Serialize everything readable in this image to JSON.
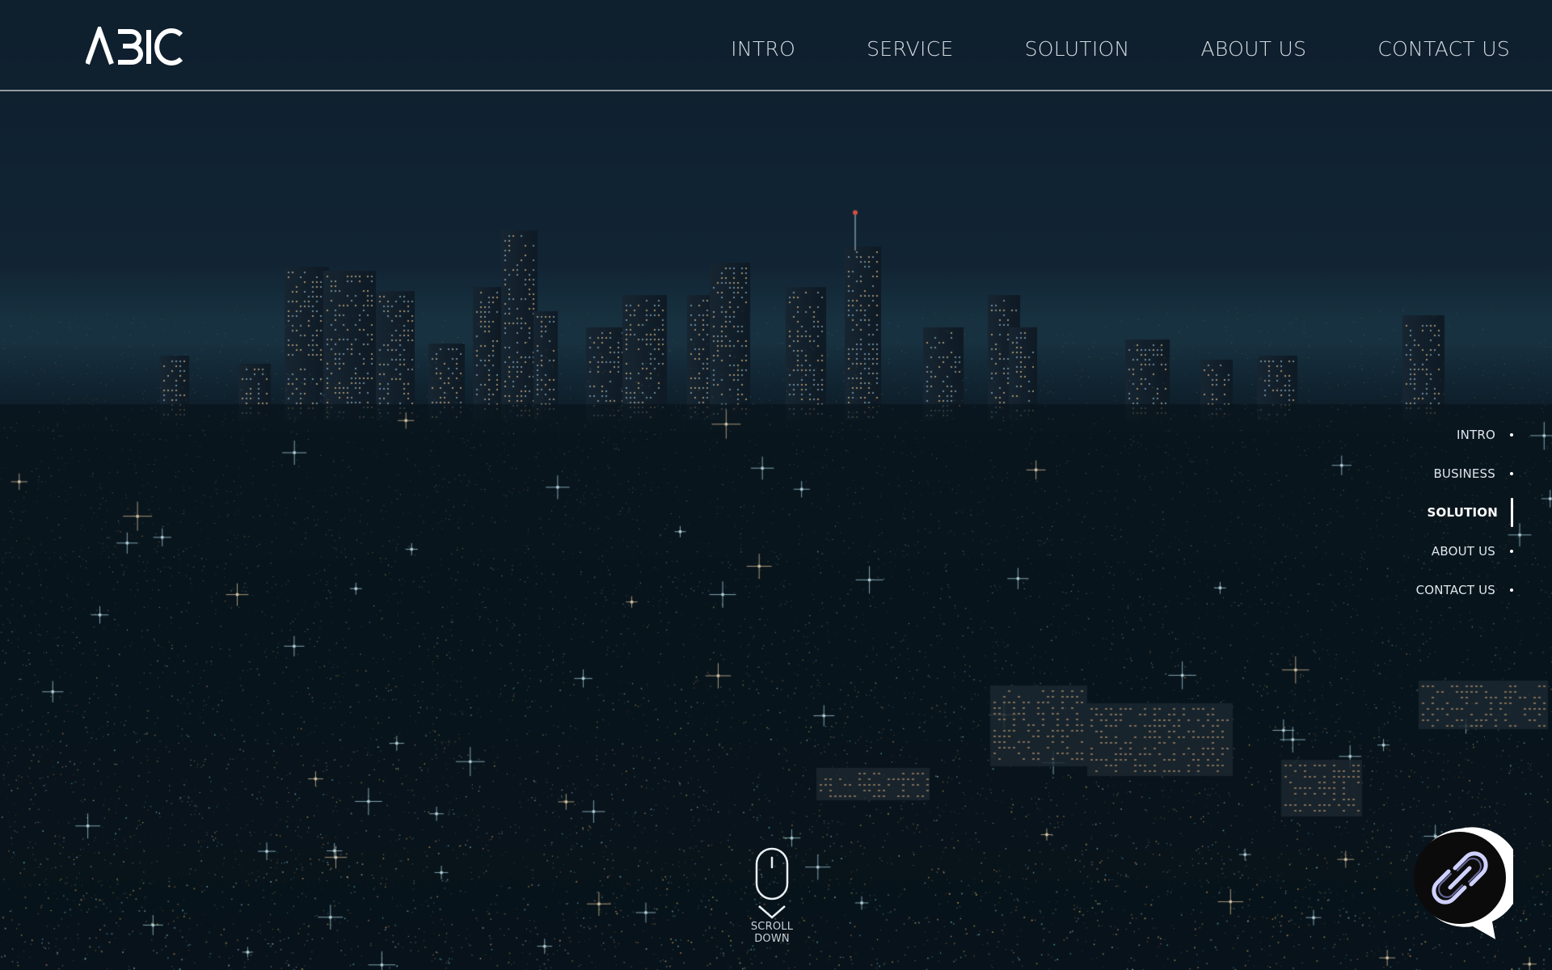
{
  "brand": {
    "logo_text": "ABIC"
  },
  "nav": {
    "items": [
      {
        "label": "INTRO"
      },
      {
        "label": "SERVICE"
      },
      {
        "label": "SOLUTION"
      },
      {
        "label": "ABOUT US"
      },
      {
        "label": "CONTACT US"
      }
    ]
  },
  "side_nav": {
    "items": [
      {
        "label": "INTRO",
        "active": false
      },
      {
        "label": "BUSINESS",
        "active": false
      },
      {
        "label": "SOLUTION",
        "active": true
      },
      {
        "label": "ABOUT US",
        "active": false
      },
      {
        "label": "CONTACT US",
        "active": false
      }
    ]
  },
  "scroll_hint": {
    "label": "SCROLL DOWN",
    "icon": "mouse-icon"
  },
  "fab": {
    "icon": "link-icon"
  },
  "background": {
    "icon": "city-night-photo"
  },
  "colors": {
    "text": "#e6ecf1",
    "sky": "#0d1f2d",
    "accent_light_warm": "#ffc67a",
    "accent_light_cool": "#7fe6ff"
  }
}
